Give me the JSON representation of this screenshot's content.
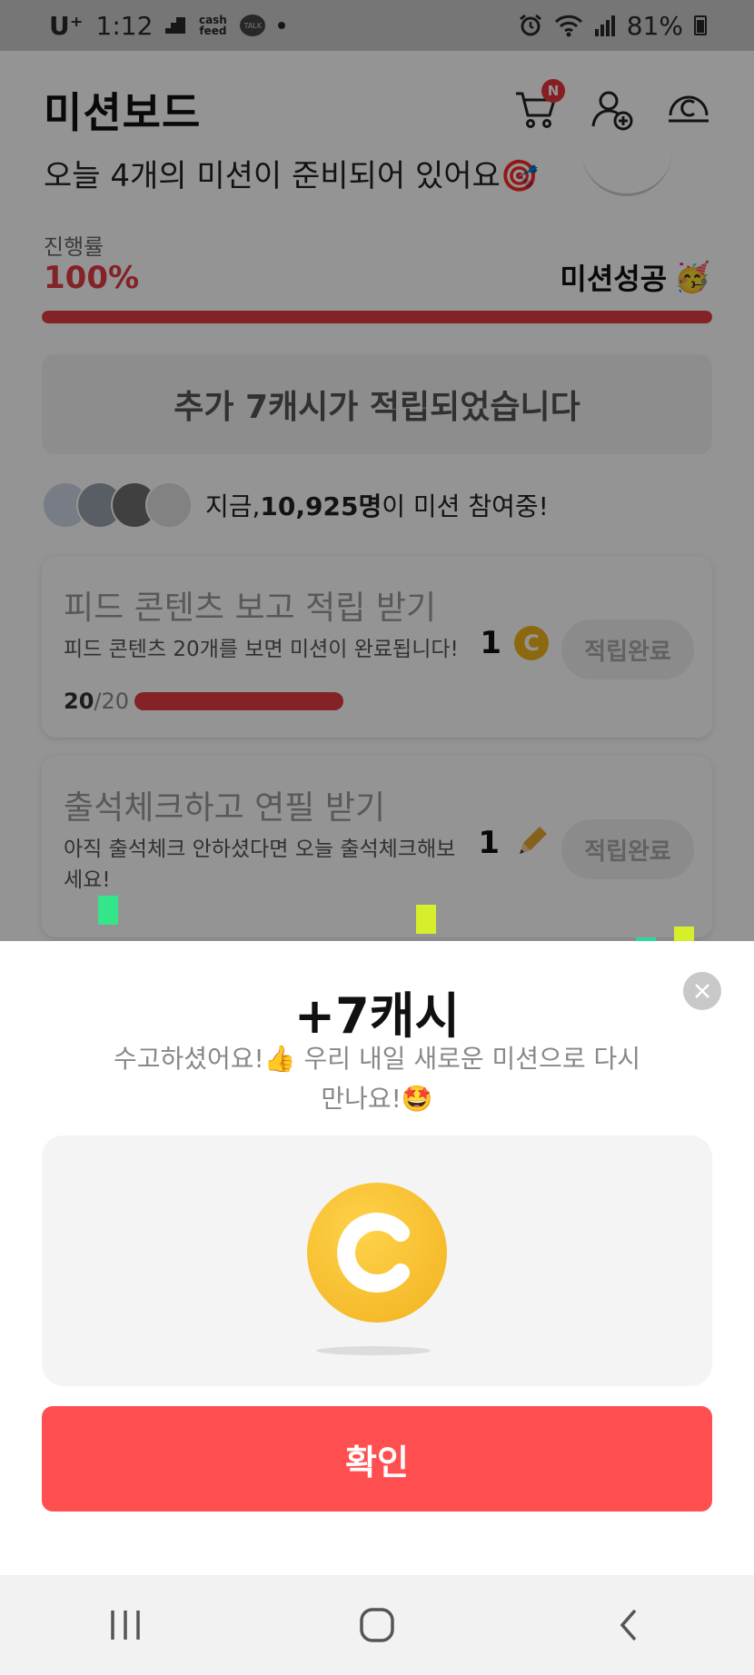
{
  "status_bar": {
    "carrier": "U⁺",
    "time": "1:12",
    "cashfeed_label": "cash feed",
    "talk_label": "TALK",
    "battery": "81%"
  },
  "header": {
    "title": "미션보드",
    "cart_badge": "N",
    "icons": [
      "cart-icon",
      "add-friend-icon",
      "cash-icon"
    ]
  },
  "board": {
    "clipped_headline": "오늘 4개의 미션이 준비되어 있어요🎯",
    "progress_label": "진행률",
    "progress_value": "100%",
    "progress_fraction": 1.0,
    "success_label": "미션성공",
    "success_emoji": "🥳",
    "added_message": "추가 7캐시가 적립되었습니다",
    "participants_prefix": "지금, ",
    "participants_count": "10,925명",
    "participants_suffix": "이 미션 참여중!"
  },
  "missions": [
    {
      "title": "피드 콘텐츠 보고 적립 받기",
      "desc": "피드 콘텐츠 20개를 보면 미션이 완료됩니다!",
      "count_done": "20",
      "count_total": "/20",
      "reward": "1",
      "reward_icon": "coin-icon",
      "button": "적립완료"
    },
    {
      "title": "출석체크하고 연필 받기",
      "desc": "아직 출석체크 안하셨다면 오늘 출석체크해보세요!",
      "reward": "1",
      "reward_icon": "pencil-icon",
      "button": "적립완료"
    }
  ],
  "sheet": {
    "title": "+7캐시",
    "message_line1": "수고하셨어요!👍 우리 내일 새로운 미션으로 다시",
    "message_line2": "만나요!🤩",
    "confirm_label": "확인"
  },
  "nav": {
    "buttons": [
      "recent-apps-icon",
      "home-icon",
      "back-icon"
    ]
  },
  "colors": {
    "accent_red": "#e23c44",
    "confirm_red": "#ff4f50",
    "coin_gold": "#f2b51b"
  }
}
